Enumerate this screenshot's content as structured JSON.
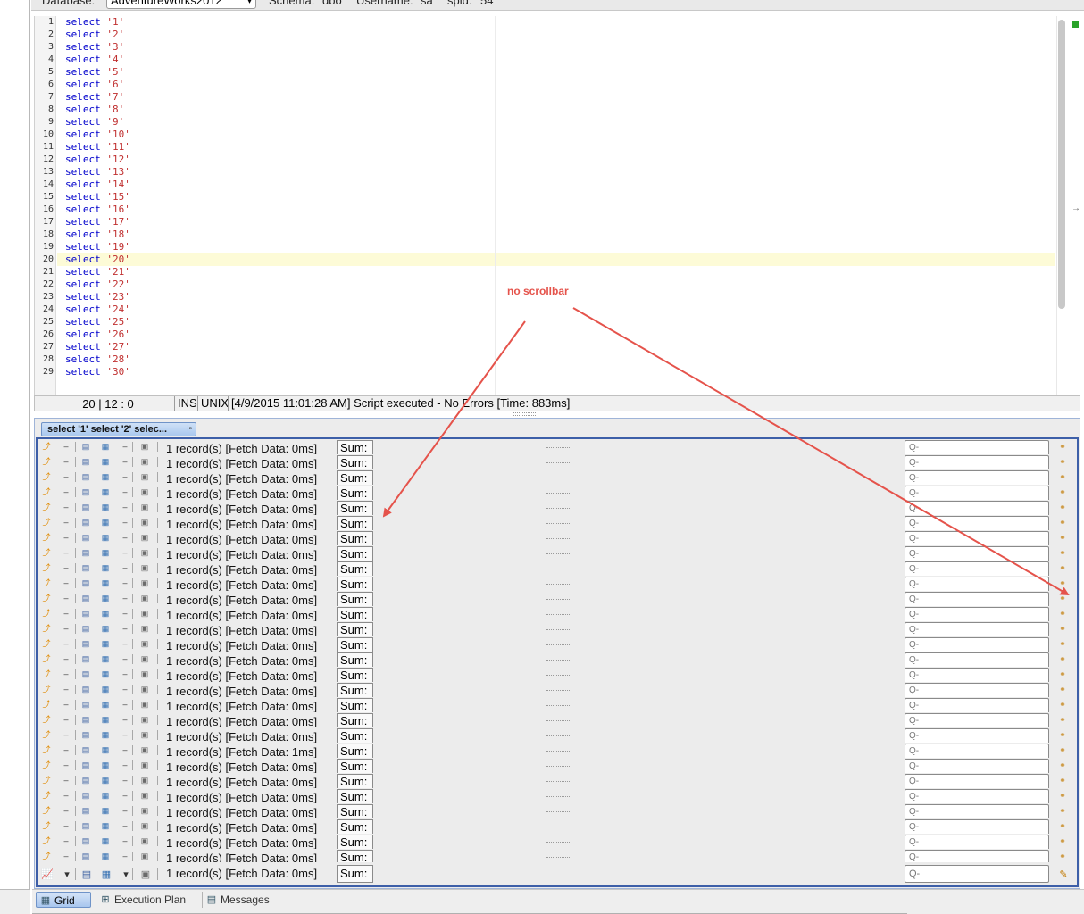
{
  "info_bar": {
    "database_label": "Database:",
    "database_value": "AdventureWorks2012",
    "schema_label": "Schema:",
    "schema_value": "dbo",
    "username_label": "Username:",
    "username_value": "sa",
    "spid_label": "spid:",
    "spid_value": "54"
  },
  "editor": {
    "line_numbers": [
      "1",
      "2",
      "3",
      "4",
      "5",
      "6",
      "7",
      "8",
      "9",
      "10",
      "11",
      "12",
      "13",
      "14",
      "15",
      "16",
      "17",
      "18",
      "19",
      "20",
      "21",
      "22",
      "23",
      "24",
      "25",
      "26",
      "27",
      "28",
      "29"
    ],
    "keyword": "select",
    "literals": [
      "'1'",
      "'2'",
      "'3'",
      "'4'",
      "'5'",
      "'6'",
      "'7'",
      "'8'",
      "'9'",
      "'10'",
      "'11'",
      "'12'",
      "'13'",
      "'14'",
      "'15'",
      "'16'",
      "'17'",
      "'18'",
      "'19'",
      "'20'",
      "'21'",
      "'22'",
      "'23'",
      "'24'",
      "'25'",
      "'26'",
      "'27'",
      "'28'",
      "'30'"
    ],
    "current_line": "20"
  },
  "status_bar": {
    "position": "20 | 12 : 0",
    "mode": "INS",
    "line_ending": "UNIX",
    "message": "[4/9/2015 11:01:28 AM] Script executed - No Errors [Time: 883ms]"
  },
  "results": {
    "tab_label": "select '1' select '2' selec...",
    "row_record_text": "1 record(s) [Fetch Data: 0ms]",
    "row_record_text_alt": "1 record(s) [Fetch Data: 1ms]",
    "sum_label": "Sum:",
    "filter_placeholder": "Q-",
    "last_record_text": "1 record(s) [Fetch Data: 0ms]",
    "last_sum_label": "Sum:",
    "last_filter_placeholder": "Q-"
  },
  "bottom_tabs": {
    "grid": "Grid",
    "execution_plan": "Execution Plan",
    "messages": "Messages"
  },
  "annotation": {
    "text": "no scrollbar",
    "color": "#e5534b"
  },
  "colors": {
    "keyword": "#0000cc",
    "string": "#c03030",
    "highlight_line": "#fdfbd7",
    "results_border": "#3d5fa8"
  }
}
